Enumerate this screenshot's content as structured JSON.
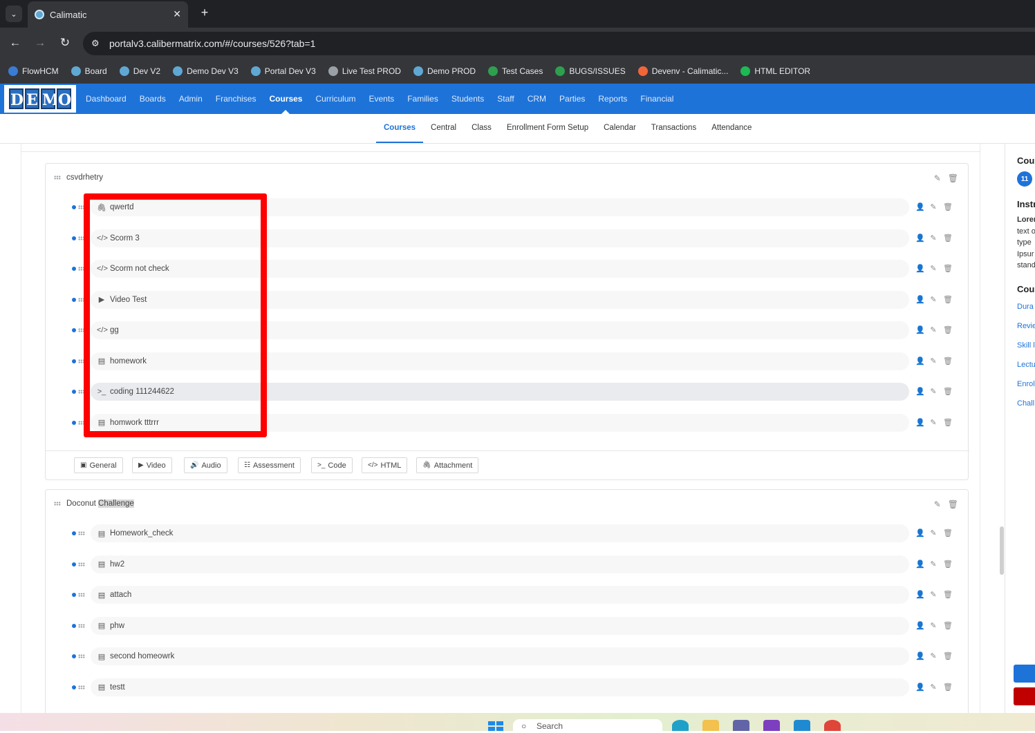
{
  "browser": {
    "tab_title": "Calimatic",
    "close_glyph": "✕",
    "newtab_glyph": "+",
    "url": "portalv3.calibermatrix.com/#/courses/526?tab=1",
    "bookmarks": [
      "FlowHCM",
      "Board",
      "Dev V2",
      "Demo Dev V3",
      "Portal Dev V3",
      "Live Test PROD",
      "Demo PROD",
      "Test Cases",
      "BUGS/ISSUES",
      "Devenv - Calimatic...",
      "HTML EDITOR"
    ]
  },
  "app": {
    "logo_letters": [
      "D",
      "E",
      "M",
      "O"
    ],
    "nav": [
      "Dashboard",
      "Boards",
      "Admin",
      "Franchises",
      "Courses",
      "Curriculum",
      "Events",
      "Families",
      "Students",
      "Staff",
      "CRM",
      "Parties",
      "Reports",
      "Financial"
    ],
    "nav_active": "Courses",
    "subnav": [
      "Courses",
      "Central",
      "Class",
      "Enrollment Form Setup",
      "Calendar",
      "Transactions",
      "Attendance"
    ],
    "subnav_active": "Courses"
  },
  "sections": [
    {
      "title": "csvdrhetry",
      "items": [
        {
          "icon": "paperclip-icon",
          "glyph": "🖇",
          "label": "qwertd"
        },
        {
          "icon": "code-icon",
          "glyph": "</>",
          "label": "Scorm 3"
        },
        {
          "icon": "code-icon",
          "glyph": "</>",
          "label": "Scorm not check"
        },
        {
          "icon": "play-icon",
          "glyph": "▶",
          "label": "Video Test"
        },
        {
          "icon": "code-icon",
          "glyph": "</>",
          "label": "gg"
        },
        {
          "icon": "clipboard-icon",
          "glyph": "▤",
          "label": "homework"
        },
        {
          "icon": "terminal-icon",
          "glyph": ">_",
          "label": "coding 111244622"
        },
        {
          "icon": "clipboard-icon",
          "glyph": "▤",
          "label": "homwork tttrrr"
        }
      ],
      "add_buttons": [
        {
          "glyph": "▣",
          "label": "General"
        },
        {
          "glyph": "▶",
          "label": "Video"
        },
        {
          "glyph": "🔊",
          "label": "Audio"
        },
        {
          "glyph": "☷",
          "label": "Assessment"
        },
        {
          "glyph": ">_",
          "label": "Code"
        },
        {
          "glyph": "</>",
          "label": "HTML"
        },
        {
          "glyph": "🖇",
          "label": "Attachment"
        }
      ]
    },
    {
      "title_plain": "Doconut ",
      "title_highlight": "Challenge",
      "items": [
        {
          "icon": "clipboard-icon",
          "glyph": "▤",
          "label": "Homework_check"
        },
        {
          "icon": "clipboard-icon",
          "glyph": "▤",
          "label": "hw2"
        },
        {
          "icon": "clipboard-icon",
          "glyph": "▤",
          "label": "attach"
        },
        {
          "icon": "clipboard-icon",
          "glyph": "▤",
          "label": "phw"
        },
        {
          "icon": "clipboard-icon",
          "glyph": "▤",
          "label": "second homeowrk"
        },
        {
          "icon": "clipboard-icon",
          "glyph": "▤",
          "label": "testt"
        }
      ]
    }
  ],
  "row_action_glyphs": {
    "assign": "👤",
    "edit": "✎",
    "delete": "🗑"
  },
  "right_panel": {
    "heading1": "Cou",
    "badge": "11",
    "heading2": "Instr",
    "text_lines": [
      "Lorem",
      "text o",
      "type",
      "Ipsur",
      "stand"
    ],
    "heading3": "Cou",
    "links": [
      "Dura",
      "Revie",
      "Skill l",
      "Lectu",
      "Enrol",
      "Chall"
    ]
  },
  "taskbar": {
    "search_placeholder": "Search"
  },
  "colors": {
    "brand_blue": "#1e73d8",
    "highlight_red": "#ff0000",
    "delete_red": "#c00000"
  }
}
